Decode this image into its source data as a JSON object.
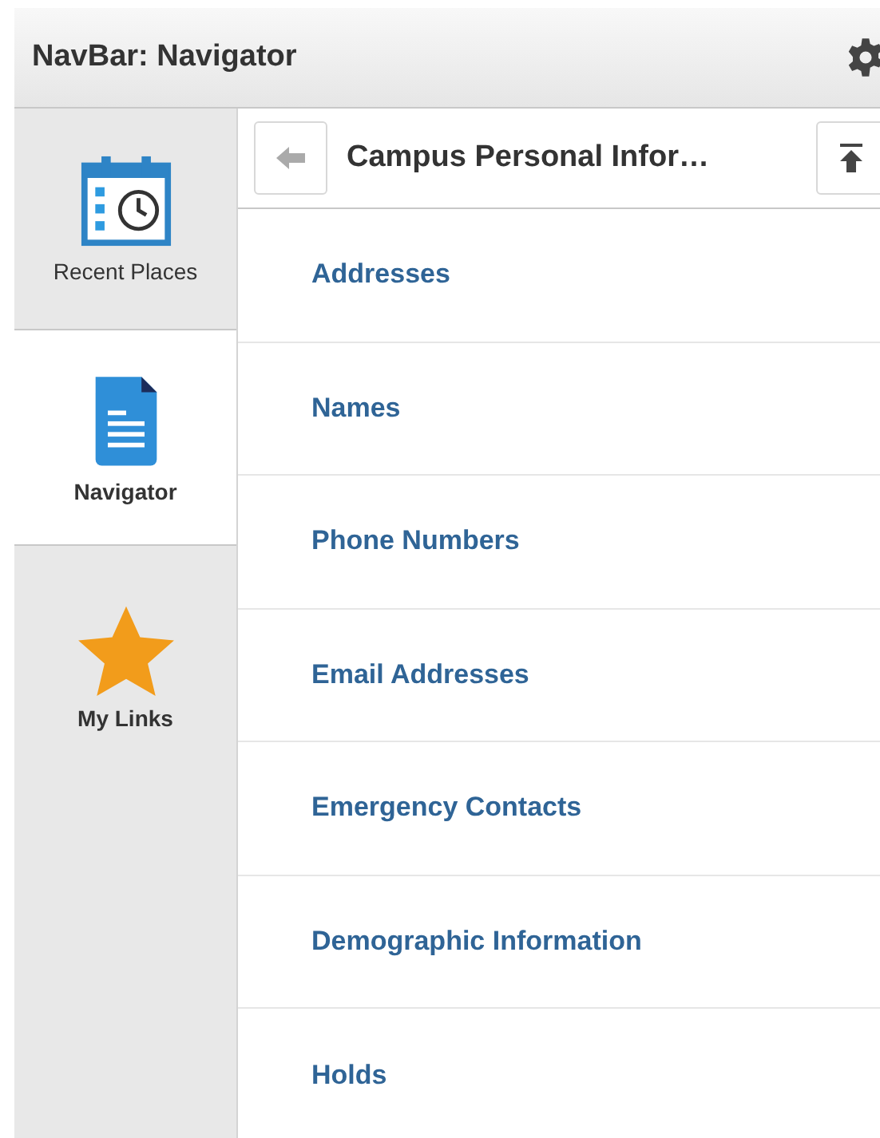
{
  "header": {
    "title": "NavBar: Navigator"
  },
  "sidebar": {
    "items": [
      {
        "label": "Recent Places",
        "kind": "calendar",
        "selected": false
      },
      {
        "label": "Navigator",
        "kind": "document",
        "selected": true
      },
      {
        "label": "My Links",
        "kind": "star",
        "selected": false
      }
    ]
  },
  "panel": {
    "title": "Campus Personal Infor…",
    "items": [
      "Addresses",
      "Names",
      "Phone Numbers",
      "Email Addresses",
      "Emergency Contacts",
      "Demographic Information",
      "Holds"
    ]
  }
}
